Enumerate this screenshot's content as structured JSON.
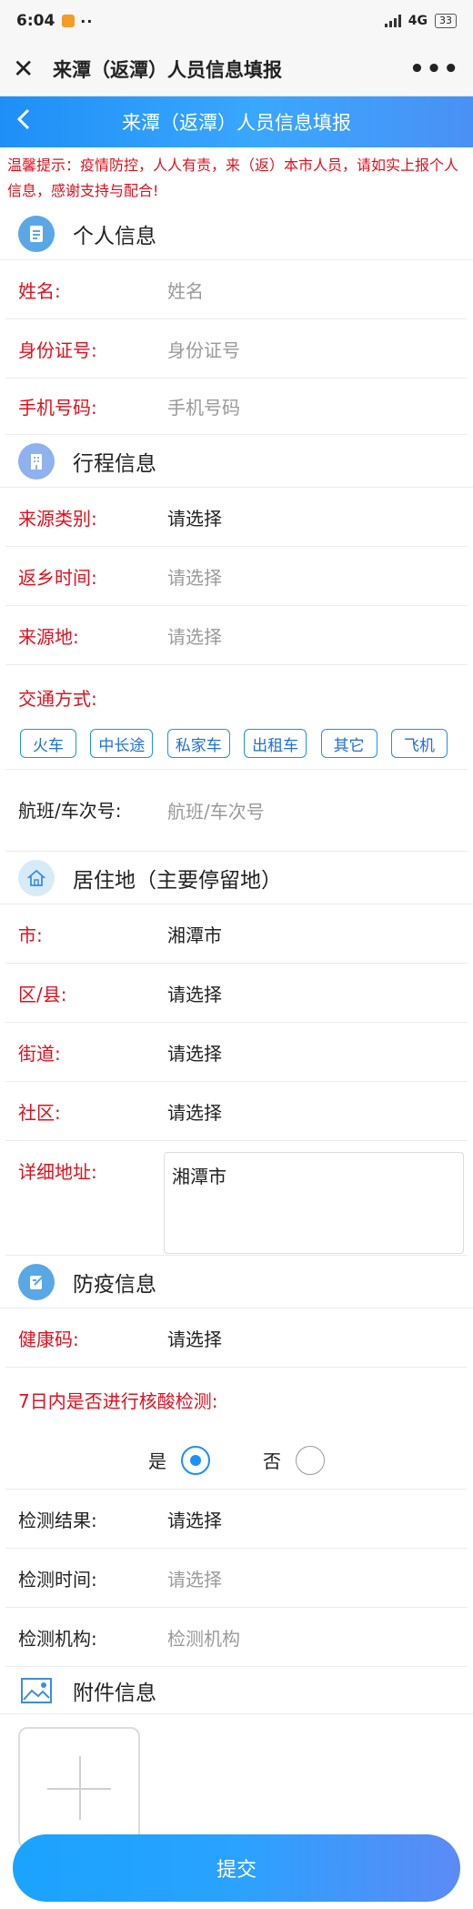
{
  "status_bar": {
    "time": "6:04",
    "dots": "··",
    "network": "4G",
    "battery": "33"
  },
  "wechat_bar": {
    "title": "来潭（返潭）人员信息填报",
    "more": "•••"
  },
  "header": {
    "title": "来潭（返潭）人员信息填报"
  },
  "tip": "温馨提示：疫情防控，人人有责，来（返）本市人员，请如实上报个人信息，感谢支持与配合!",
  "personal": {
    "title": "个人信息",
    "name": {
      "label": "姓名:",
      "placeholder": "姓名"
    },
    "id_card": {
      "label": "身份证号:",
      "placeholder": "身份证号"
    },
    "phone": {
      "label": "手机号码:",
      "placeholder": "手机号码"
    }
  },
  "trip": {
    "title": "行程信息",
    "source_type": {
      "label": "来源类别:",
      "value": "请选择"
    },
    "return_time": {
      "label": "返乡时间:",
      "placeholder": "请选择"
    },
    "source_place": {
      "label": "来源地:",
      "placeholder": "请选择"
    },
    "transport_label": "交通方式:",
    "transport_options": [
      "火车",
      "中长途",
      "私家车",
      "出租车",
      "其它",
      "飞机"
    ],
    "flight": {
      "label": "航班/车次号:",
      "placeholder": "航班/车次号"
    }
  },
  "residence": {
    "title": "居住地（主要停留地）",
    "city": {
      "label": "市:",
      "value": "湘潭市"
    },
    "district": {
      "label": "区/县:",
      "value": "请选择"
    },
    "street": {
      "label": "街道:",
      "value": "请选择"
    },
    "community": {
      "label": "社区:",
      "value": "请选择"
    },
    "address": {
      "label": "详细地址:",
      "value": "湘潭市"
    }
  },
  "epidemic": {
    "title": "防疫信息",
    "health_code": {
      "label": "健康码:",
      "value": "请选择"
    },
    "nucleic_question": "7日内是否进行核酸检测:",
    "yes_label": "是",
    "no_label": "否",
    "selected": "yes",
    "result": {
      "label": "检测结果:",
      "value": "请选择"
    },
    "time": {
      "label": "检测时间:",
      "placeholder": "请选择"
    },
    "agency": {
      "label": "检测机构:",
      "placeholder": "检测机构"
    }
  },
  "attachment": {
    "title": "附件信息"
  },
  "submit_label": "提交",
  "colors": {
    "accent": "#1e8ff7",
    "required_label": "#e0101e",
    "placeholder": "#9a9a9a"
  }
}
